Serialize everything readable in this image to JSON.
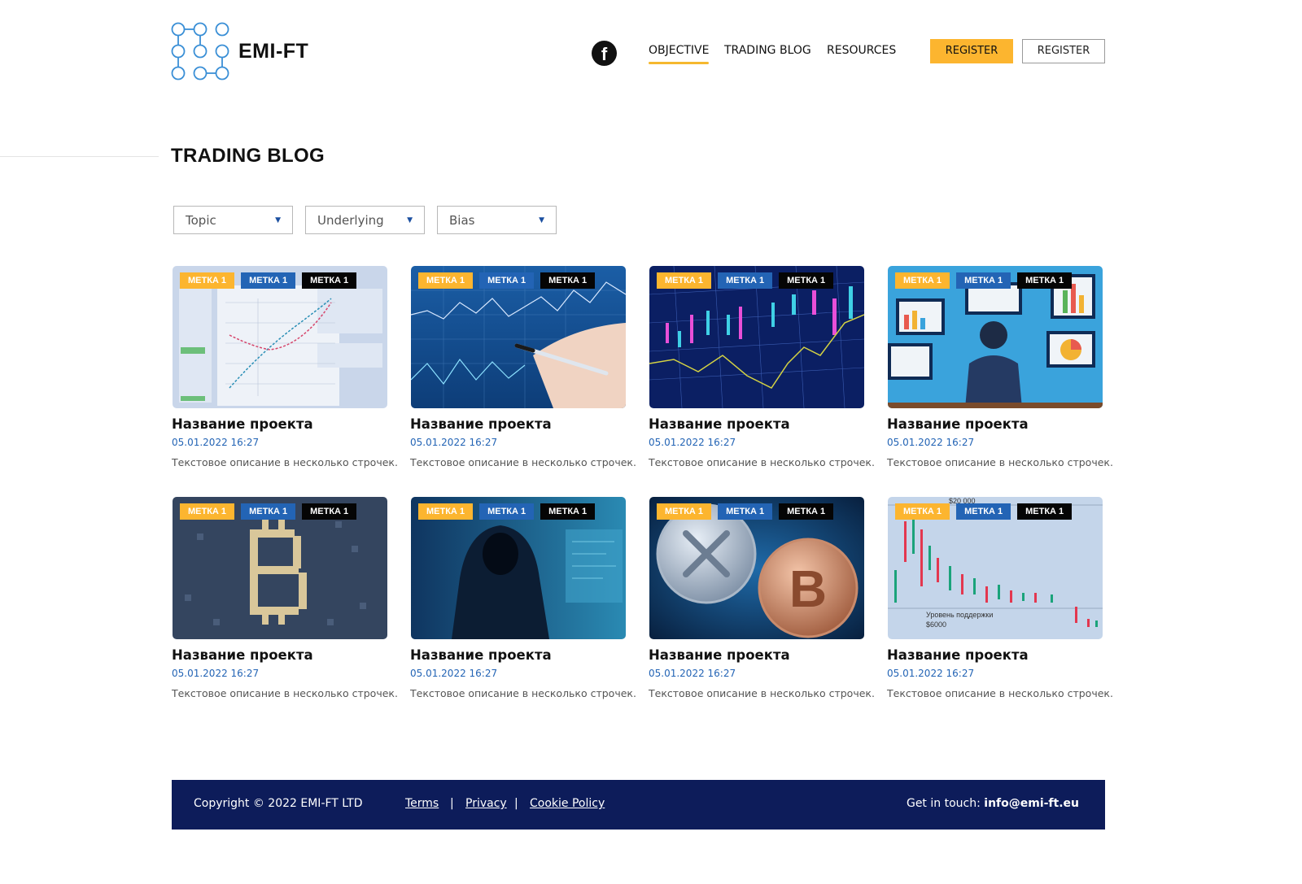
{
  "header": {
    "logo_text": "EMI-FT",
    "facebook_glyph": "f",
    "nav": [
      {
        "label": "OBJECTIVE",
        "active": true
      },
      {
        "label": "TRADING BLOG",
        "active": false
      },
      {
        "label": "RESOURCES",
        "active": false
      }
    ],
    "register_primary": "REGISTER",
    "register_secondary": "REGISTER"
  },
  "page": {
    "title": "TRADING BLOG"
  },
  "filters": [
    {
      "label": "Topic",
      "caret": "▼"
    },
    {
      "label": "Underlying",
      "caret": "▼"
    },
    {
      "label": "Bias",
      "caret": "▼"
    }
  ],
  "cards": [
    {
      "image": "profit-loss-chart",
      "tags": [
        "МЕТКА 1",
        "МЕТКА 1",
        "МЕТКА 1"
      ],
      "title": "Название проекта",
      "date": "05.01.2022 16:27",
      "desc": "Текстовое описание в несколько строчек."
    },
    {
      "image": "hand-pen-chart",
      "tags": [
        "МЕТКА 1",
        "МЕТКА 1",
        "МЕТКА 1"
      ],
      "title": "Название проекта",
      "date": "05.01.2022 16:27",
      "desc": "Текстовое описание в несколько строчек."
    },
    {
      "image": "candlestick-board",
      "tags": [
        "МЕТКА 1",
        "МЕТКА 1",
        "МЕТКА 1"
      ],
      "title": "Название проекта",
      "date": "05.01.2022 16:27",
      "desc": "Текстовое описание в несколько строчек."
    },
    {
      "image": "analyst-monitors",
      "tags": [
        "МЕТКА 1",
        "МЕТКА 1",
        "МЕТКА 1"
      ],
      "title": "Название проекта",
      "date": "05.01.2022 16:27",
      "desc": "Текстовое описание в несколько строчек."
    },
    {
      "image": "bitcoin-circuit",
      "tags": [
        "МЕТКА 1",
        "МЕТКА 1",
        "МЕТКА 1"
      ],
      "title": "Название проекта",
      "date": "05.01.2022 16:27",
      "desc": "Текстовое описание в несколько строчек."
    },
    {
      "image": "hooded-hacker",
      "tags": [
        "МЕТКА 1",
        "МЕТКА 1",
        "МЕТКА 1"
      ],
      "title": "Название проекта",
      "date": "05.01.2022 16:27",
      "desc": "Текстовое описание в несколько строчек."
    },
    {
      "image": "crypto-coins",
      "tags": [
        "МЕТКА 1",
        "МЕТКА 1",
        "МЕТКА 1"
      ],
      "title": "Название проекта",
      "date": "05.01.2022 16:27",
      "desc": "Текстовое описание в несколько строчек."
    },
    {
      "image": "btc-price-chart",
      "tags": [
        "МЕТКА 1",
        "МЕТКА 1",
        "МЕТКА 1"
      ],
      "title": "Название проекта",
      "date": "05.01.2022 16:27",
      "desc": "Текстовое описание в несколько строчек.",
      "image_text": {
        "price": "$20 000",
        "support": "Уровень поддержки",
        "support_price": "$6000"
      }
    }
  ],
  "footer": {
    "copyright": "Copyright © 2022 EMI-FT LTD",
    "links": [
      "Terms",
      "Privacy",
      "Cookie Policy"
    ],
    "separator": "|",
    "contact_label": "Get in touch:",
    "contact_email": "info@emi-ft.eu"
  },
  "colors": {
    "accent_yellow": "#fcb52f",
    "tag_blue": "#2364b5",
    "date_blue": "#2364b5",
    "footer_navy": "#0d1c5a",
    "logo_blue": "#3a8fd6"
  }
}
